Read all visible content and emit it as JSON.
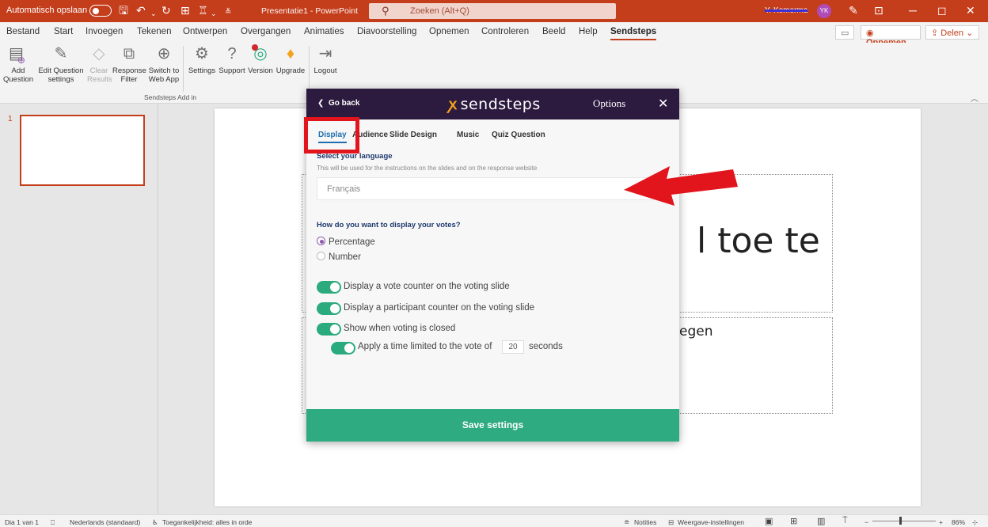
{
  "titlebar": {
    "autosave_label": "Automatisch opslaan",
    "document_title": "Presentatie1  -  PowerPoint",
    "search_placeholder": "Zoeken (Alt+Q)",
    "username": "Y. Kemerma",
    "avatar_initials": "YK"
  },
  "menu": {
    "tabs": [
      "Bestand",
      "Start",
      "Invoegen",
      "Tekenen",
      "Ontwerpen",
      "Overgangen",
      "Animaties",
      "Diavoorstelling",
      "Opnemen",
      "Controleren",
      "Beeld",
      "Help",
      "Sendsteps"
    ],
    "record_label": "Opnemen",
    "share_label": "Delen"
  },
  "ribbon": {
    "buttons": [
      {
        "line1": "Add",
        "line2": "Question"
      },
      {
        "line1": "Edit Question",
        "line2": "settings"
      },
      {
        "line1": "Clear",
        "line2": "Results"
      },
      {
        "line1": "Response",
        "line2": "Filter"
      },
      {
        "line1": "Switch to",
        "line2": "Web App"
      },
      {
        "line1": "Settings",
        "line2": ""
      },
      {
        "line1": "Support",
        "line2": ""
      },
      {
        "line1": "Version",
        "line2": ""
      },
      {
        "line1": "Upgrade",
        "line2": ""
      },
      {
        "line1": "Logout",
        "line2": ""
      }
    ],
    "group_label": "Sendsteps Add in"
  },
  "slides": {
    "current_number": "1"
  },
  "slide": {
    "title_fragment": "l toe te",
    "subtitle_fragment": "egen"
  },
  "dialog": {
    "go_back": "Go back",
    "logo_text": "sendsteps",
    "options_label": "Options",
    "tabs": [
      "Display",
      "Audience",
      "Slide Design",
      "Music",
      "Quiz Question"
    ],
    "language_heading": "Select your language",
    "language_desc": "This will be used for the instructions on the slides and on the response website",
    "language_value": "Français",
    "votes_heading": "How do you want to display your votes?",
    "radio_percentage": "Percentage",
    "radio_number": "Number",
    "toggle_vote_counter": "Display a vote counter on the voting slide",
    "toggle_participant_counter": "Display a participant counter on the voting slide",
    "toggle_voting_closed": "Show when voting is closed",
    "toggle_time_limit_pre": "Apply a time limited to the vote of",
    "time_limit_value": "20",
    "toggle_time_limit_post": "seconds",
    "save_label": "Save settings"
  },
  "statusbar": {
    "slide_info": "Dia 1 van 1",
    "language": "Nederlands (standaard)",
    "accessibility": "Toegankelijkheid: alles in orde",
    "notes": "Notities",
    "view_settings": "Weergave-instellingen",
    "zoom": "86%"
  },
  "colors": {
    "office_accent": "#c43e1c",
    "dialog_header": "#2c1a3f",
    "sendsteps_green": "#2eab80",
    "annotation_red": "#e2141c"
  }
}
